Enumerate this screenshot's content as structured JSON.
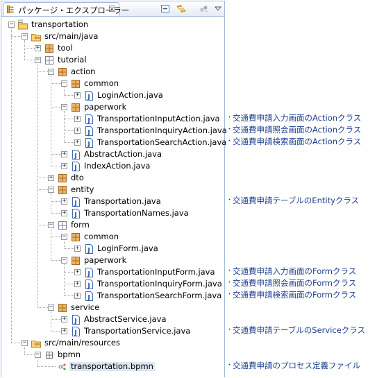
{
  "view": {
    "title": "パッケージ・エクスプローラー",
    "close": "☒"
  },
  "toolbar": {
    "collapse_icon": "collapse-all-icon",
    "link_icon": "link-with-editor-icon",
    "filter_icon": "filter-icon",
    "menu_icon": "view-menu-icon"
  },
  "tree": [
    {
      "label": "transportation",
      "type": "project",
      "depth": 0,
      "state": "expanded"
    },
    {
      "label": "src/main/java",
      "type": "srcfolder",
      "depth": 1,
      "state": "expanded"
    },
    {
      "label": "tool",
      "type": "package",
      "depth": 2,
      "state": "collapsed"
    },
    {
      "label": "tutorial",
      "type": "package-empty",
      "depth": 2,
      "state": "expanded"
    },
    {
      "label": "action",
      "type": "package",
      "depth": 3,
      "state": "expanded"
    },
    {
      "label": "common",
      "type": "package",
      "depth": 4,
      "state": "expanded"
    },
    {
      "label": "LoginAction.java",
      "type": "java",
      "depth": 5,
      "state": "collapsed"
    },
    {
      "label": "paperwork",
      "type": "package",
      "depth": 4,
      "state": "expanded"
    },
    {
      "label": "TransportationInputAction.java",
      "type": "java",
      "depth": 5,
      "state": "collapsed"
    },
    {
      "label": "TransportationInquiryAction.java",
      "type": "java",
      "depth": 5,
      "state": "collapsed"
    },
    {
      "label": "TransportationSearchAction.java",
      "type": "java",
      "depth": 5,
      "state": "collapsed"
    },
    {
      "label": "AbstractAction.java",
      "type": "java",
      "depth": 4,
      "state": "collapsed"
    },
    {
      "label": "IndexAction.java",
      "type": "java",
      "depth": 4,
      "state": "collapsed"
    },
    {
      "label": "dto",
      "type": "package",
      "depth": 3,
      "state": "collapsed"
    },
    {
      "label": "entity",
      "type": "package",
      "depth": 3,
      "state": "expanded"
    },
    {
      "label": "Transportation.java",
      "type": "java",
      "depth": 4,
      "state": "collapsed"
    },
    {
      "label": "TransportationNames.java",
      "type": "java",
      "depth": 4,
      "state": "collapsed"
    },
    {
      "label": "form",
      "type": "package-empty",
      "depth": 3,
      "state": "expanded"
    },
    {
      "label": "common",
      "type": "package",
      "depth": 4,
      "state": "expanded"
    },
    {
      "label": "LoginForm.java",
      "type": "java",
      "depth": 5,
      "state": "collapsed"
    },
    {
      "label": "paperwork",
      "type": "package",
      "depth": 4,
      "state": "expanded"
    },
    {
      "label": "TransportationInputForm.java",
      "type": "java",
      "depth": 5,
      "state": "collapsed"
    },
    {
      "label": "TransportationInquiryForm.java",
      "type": "java",
      "depth": 5,
      "state": "collapsed"
    },
    {
      "label": "TransportationSearchForm.java",
      "type": "java",
      "depth": 5,
      "state": "collapsed"
    },
    {
      "label": "service",
      "type": "package",
      "depth": 3,
      "state": "expanded"
    },
    {
      "label": "AbstractService.java",
      "type": "java",
      "depth": 4,
      "state": "collapsed"
    },
    {
      "label": "TransportationService.java",
      "type": "java",
      "depth": 4,
      "state": "collapsed"
    },
    {
      "label": "src/main/resources",
      "type": "srcfolder",
      "depth": 1,
      "state": "expanded"
    },
    {
      "label": "bpmn",
      "type": "folder",
      "depth": 2,
      "state": "expanded"
    },
    {
      "label": "transportation.bpmn",
      "type": "bpmn",
      "depth": 3,
      "state": "leaf",
      "selected": true
    }
  ],
  "annotations": [
    {
      "row": 8,
      "text": "交通費申請入力画面のActionクラス"
    },
    {
      "row": 9,
      "text": "交通費申請照会画面のActionクラス"
    },
    {
      "row": 10,
      "text": "交通費申請検索画面のActionクラス"
    },
    {
      "row": 15,
      "text": "交通費申請テーブルのEntityクラス"
    },
    {
      "row": 21,
      "text": "交通費申請入力画面のFormクラス"
    },
    {
      "row": 22,
      "text": "交通費申請照会画面のFormクラス"
    },
    {
      "row": 23,
      "text": "交通費申請検索画面のFormクラス"
    },
    {
      "row": 26,
      "text": "交通費申請テーブルのServiceクラス"
    },
    {
      "row": 29,
      "text": "交通費申請のプロセス定義ファイル"
    }
  ],
  "colors": {
    "border": "#a3b9d6",
    "package": "#c8893a",
    "java": "#3e6db6",
    "note": "#1f3f8e",
    "selection": "#dde6f2"
  }
}
